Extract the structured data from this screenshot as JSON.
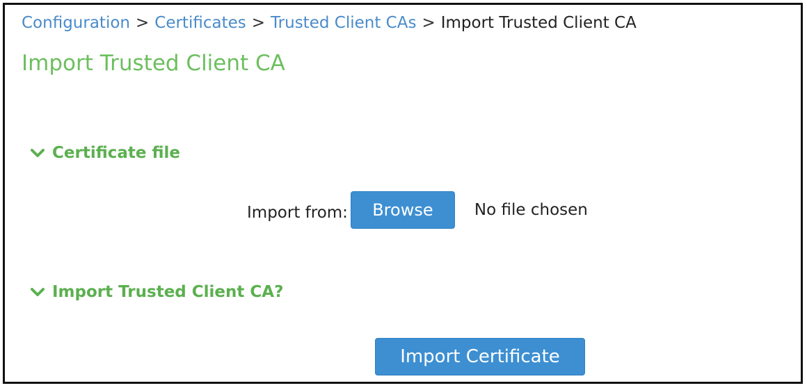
{
  "breadcrumb": {
    "items": [
      {
        "label": "Configuration",
        "link": true
      },
      {
        "label": "Certificates",
        "link": true
      },
      {
        "label": "Trusted Client CAs",
        "link": true
      },
      {
        "label": "Import Trusted Client CA",
        "link": false
      }
    ],
    "separator": ">"
  },
  "page": {
    "title": "Import Trusted Client CA"
  },
  "sections": {
    "certificate_file": {
      "label": "Certificate file",
      "icon": "chevron-down-icon"
    },
    "import_confirm": {
      "label": "Import Trusted Client CA?",
      "icon": "chevron-down-icon"
    }
  },
  "file_input": {
    "label": "Import from:",
    "browse_label": "Browse",
    "status": "No file chosen"
  },
  "actions": {
    "import_label": "Import Certificate"
  },
  "colors": {
    "link": "#4a8bc9",
    "section_green": "#5bb04f",
    "title_green": "#6cbf5e",
    "button_blue": "#3d8fd2"
  }
}
